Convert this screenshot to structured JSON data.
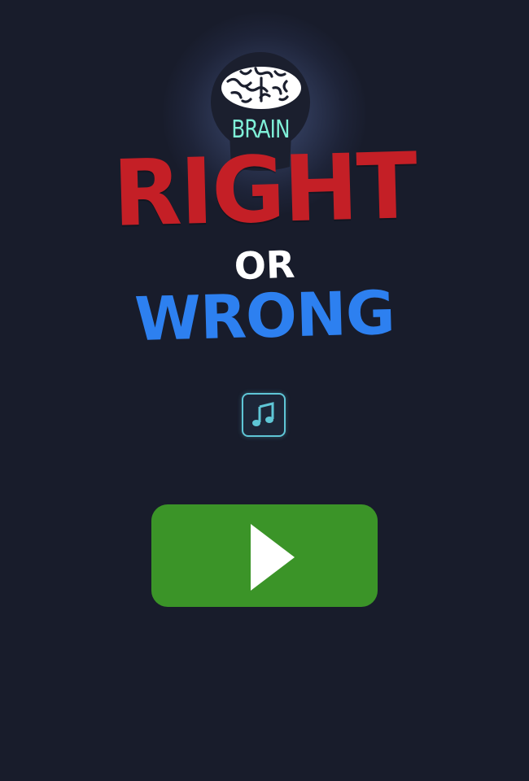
{
  "game": {
    "logo": {
      "brain_label": "BRAIN",
      "title_right": "RIGHT",
      "title_or": "OR",
      "title_wrong": "WRONG",
      "icon": "brain-lightbulb-icon"
    },
    "controls": {
      "music_icon": "music-note-icon",
      "play_icon": "play-icon"
    }
  },
  "colors": {
    "background": "#181c2b",
    "right_red": "#c41f26",
    "wrong_blue": "#2d80f0",
    "brain_label_teal": "#7ff0d8",
    "music_accent": "#5fc6d6",
    "play_green": "#3b9428"
  }
}
